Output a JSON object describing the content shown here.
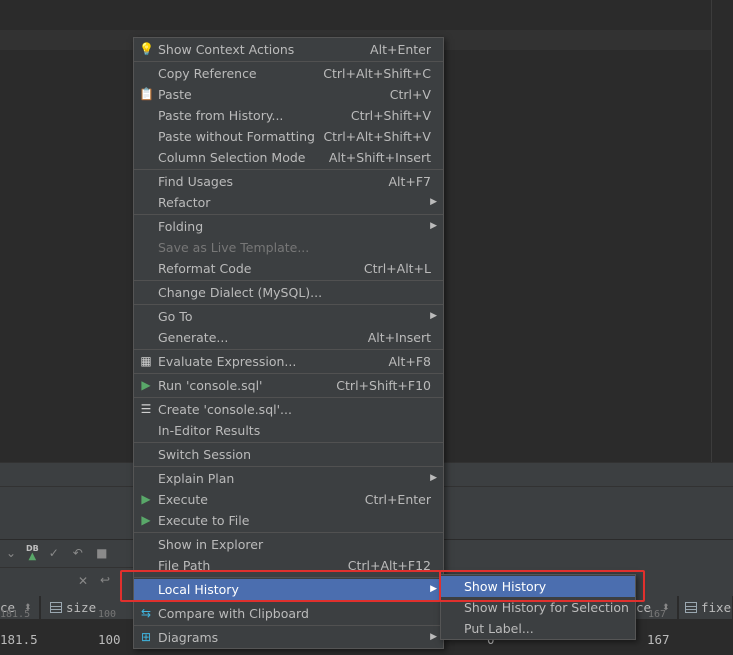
{
  "menu": {
    "items": [
      {
        "label": "Show Context Actions",
        "shortcut": "Alt+Enter",
        "icon": "lightbulb-icon"
      },
      {
        "label": "Copy Reference",
        "shortcut": "Ctrl+Alt+Shift+C"
      },
      {
        "label": "Paste",
        "shortcut": "Ctrl+V",
        "icon": "clipboard-icon"
      },
      {
        "label": "Paste from History...",
        "shortcut": "Ctrl+Shift+V"
      },
      {
        "label": "Paste without Formatting",
        "shortcut": "Ctrl+Alt+Shift+V"
      },
      {
        "label": "Column Selection Mode",
        "shortcut": "Alt+Shift+Insert"
      },
      {
        "label": "Find Usages",
        "shortcut": "Alt+F7"
      },
      {
        "label": "Refactor",
        "submenu": true
      },
      {
        "label": "Folding",
        "submenu": true
      },
      {
        "label": "Save as Live Template...",
        "disabled": true
      },
      {
        "label": "Reformat Code",
        "shortcut": "Ctrl+Alt+L"
      },
      {
        "label": "Change Dialect (MySQL)..."
      },
      {
        "label": "Go To",
        "submenu": true
      },
      {
        "label": "Generate...",
        "shortcut": "Alt+Insert"
      },
      {
        "label": "Evaluate Expression...",
        "shortcut": "Alt+F8",
        "icon": "calculator-icon"
      },
      {
        "label": "Run 'console.sql'",
        "shortcut": "Ctrl+Shift+F10",
        "icon": "run-icon"
      },
      {
        "label": "Create 'console.sql'...",
        "icon": "database-icon"
      },
      {
        "label": "In-Editor Results"
      },
      {
        "label": "Switch Session"
      },
      {
        "label": "Explain Plan",
        "submenu": true
      },
      {
        "label": "Execute",
        "shortcut": "Ctrl+Enter",
        "icon": "execute-icon"
      },
      {
        "label": "Execute to File",
        "icon": "execute-to-file-icon"
      },
      {
        "label": "Show in Explorer"
      },
      {
        "label": "File Path",
        "shortcut": "Ctrl+Alt+F12"
      },
      {
        "label": "Local History",
        "submenu": true,
        "active": true
      },
      {
        "label": "Compare with Clipboard",
        "icon": "compare-icon"
      },
      {
        "label": "Diagrams",
        "submenu": true,
        "icon": "diagram-icon"
      }
    ]
  },
  "submenu": {
    "items": [
      {
        "label": "Show History",
        "active": true
      },
      {
        "label": "Show History for Selection"
      },
      {
        "label": "Put Label..."
      }
    ]
  },
  "grid": {
    "headers": [
      "ce",
      "size",
      "ce",
      "fixe"
    ],
    "row_prev": [
      "181.5",
      "100",
      "167"
    ],
    "row": [
      "181.5",
      "100",
      "0",
      "167"
    ]
  },
  "colors": {
    "menu_bg": "#3c3f41",
    "selection": "#4b6eaf",
    "highlight_box": "#e0302d",
    "run_green": "#59a869"
  }
}
